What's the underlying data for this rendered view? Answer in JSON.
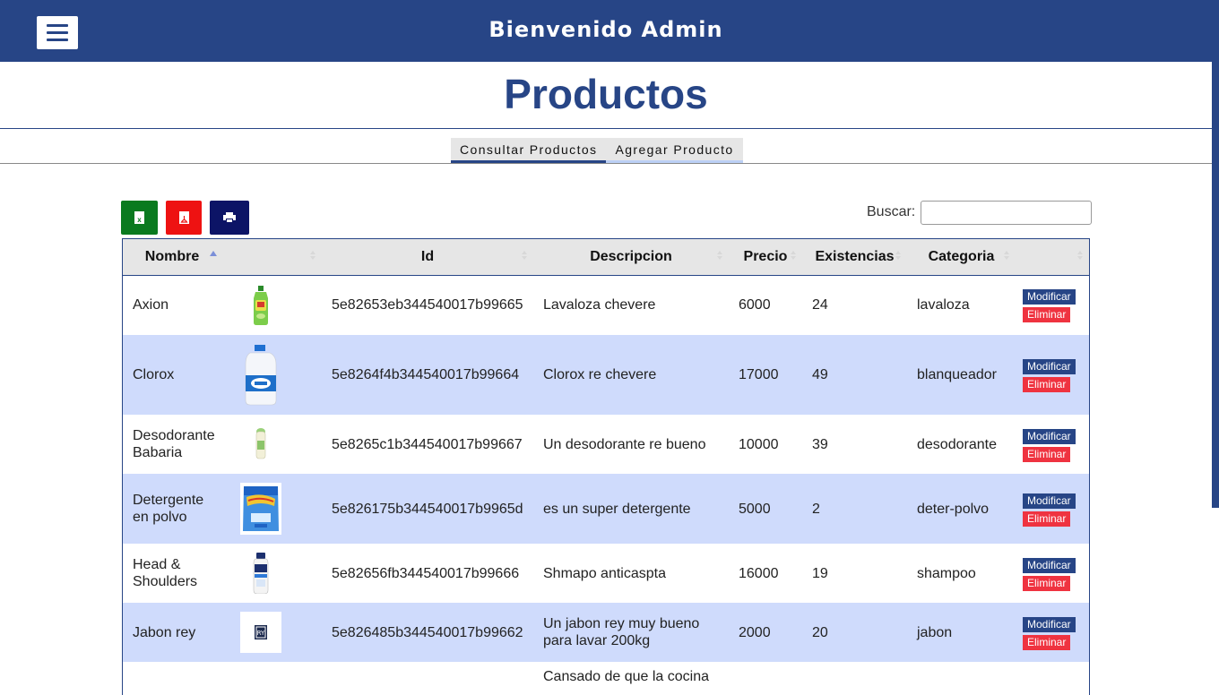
{
  "header": {
    "welcome": "Bienvenido Admin"
  },
  "page": {
    "title": "Productos"
  },
  "tabs": [
    {
      "label": "Consultar Productos",
      "active": true
    },
    {
      "label": "Agregar Producto",
      "active": false
    }
  ],
  "toolbar": {
    "excel_icon": "excel-icon",
    "pdf_icon": "pdf-icon",
    "print_icon": "print-icon",
    "excel_glyph": "x"
  },
  "search": {
    "label": "Buscar:",
    "value": ""
  },
  "table": {
    "headers": [
      "Nombre",
      "",
      "Id",
      "Descripcion",
      "Precio",
      "Existencias",
      "Categoria",
      ""
    ],
    "rows": [
      {
        "nombre": "Axion",
        "id": "5e82653eb344540017b99665",
        "descripcion": "Lavaloza chevere",
        "precio": "6000",
        "existencias": "24",
        "categoria": "lavaloza",
        "image": "dish-soap-bottle"
      },
      {
        "nombre": "Clorox",
        "id": "5e8264f4b344540017b99664",
        "descripcion": "Clorox re chevere",
        "precio": "17000",
        "existencias": "49",
        "categoria": "blanqueador",
        "image": "bleach-jug"
      },
      {
        "nombre": "Desodorante Babaria",
        "id": "5e8265c1b344540017b99667",
        "descripcion": "Un desodorante re bueno",
        "precio": "10000",
        "existencias": "39",
        "categoria": "desodorante",
        "image": "deodorant-bottle"
      },
      {
        "nombre": "Detergente en polvo",
        "id": "5e826175b344540017b9965d",
        "descripcion": "es un super detergente",
        "precio": "5000",
        "existencias": "2",
        "categoria": "deter-polvo",
        "image": "detergent-bag"
      },
      {
        "nombre": "Head & Shoulders",
        "id": "5e82656fb344540017b99666",
        "descripcion": "Shmapo anticaspta",
        "precio": "16000",
        "existencias": "19",
        "categoria": "shampoo",
        "image": "shampoo-bottle"
      },
      {
        "nombre": "Jabon rey",
        "id": "5e826485b344540017b99662",
        "descripcion": "Un jabon rey muy bueno para lavar 200kg",
        "precio": "2000",
        "existencias": "20",
        "categoria": "jabon",
        "image": "soap-bar"
      },
      {
        "nombre": "",
        "id": "",
        "descripcion": "Cansado de que la cocina",
        "precio": "",
        "existencias": "",
        "categoria": "",
        "image": ""
      }
    ],
    "modify_label": "Modificar",
    "delete_label": "Eliminar"
  }
}
